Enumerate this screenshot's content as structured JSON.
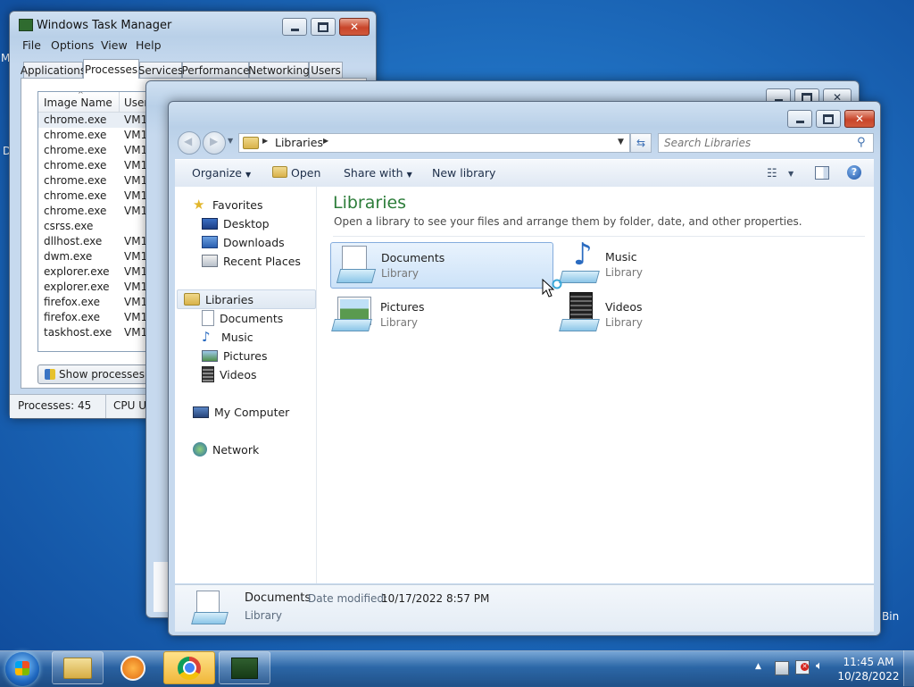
{
  "desktop": {
    "recycle_bin_label": "Bin",
    "left_edge_letters": [
      "M",
      "D"
    ]
  },
  "task_manager": {
    "title": "Windows Task Manager",
    "menu": [
      "File",
      "Options",
      "View",
      "Help"
    ],
    "tabs": [
      "Applications",
      "Processes",
      "Services",
      "Performance",
      "Networking",
      "Users"
    ],
    "columns": [
      "Image Name",
      "User Name"
    ],
    "rows": [
      {
        "name": "chrome.exe",
        "user": "VM1"
      },
      {
        "name": "chrome.exe",
        "user": "VM1"
      },
      {
        "name": "chrome.exe",
        "user": "VM1"
      },
      {
        "name": "chrome.exe",
        "user": "VM1"
      },
      {
        "name": "chrome.exe",
        "user": "VM1"
      },
      {
        "name": "chrome.exe",
        "user": "VM1"
      },
      {
        "name": "chrome.exe",
        "user": "VM1"
      },
      {
        "name": "csrss.exe",
        "user": ""
      },
      {
        "name": "dllhost.exe",
        "user": "VM1"
      },
      {
        "name": "dwm.exe",
        "user": "VM1"
      },
      {
        "name": "explorer.exe",
        "user": "VM1"
      },
      {
        "name": "explorer.exe",
        "user": "VM1"
      },
      {
        "name": "firefox.exe",
        "user": "VM1"
      },
      {
        "name": "firefox.exe",
        "user": "VM1"
      },
      {
        "name": "taskhost.exe",
        "user": "VM1"
      }
    ],
    "show_all_button": "Show processes from all u",
    "status_processes": "Processes: 45",
    "status_cpu": "CPU Usage:"
  },
  "explorer": {
    "breadcrumb": "Libraries",
    "search_placeholder": "Search Libraries",
    "toolbar": {
      "organize": "Organize",
      "open": "Open",
      "share_with": "Share with",
      "new_library": "New library"
    },
    "nav": {
      "favorites": "Favorites",
      "favorites_items": [
        "Desktop",
        "Downloads",
        "Recent Places"
      ],
      "libraries": "Libraries",
      "library_items": [
        "Documents",
        "Music",
        "Pictures",
        "Videos"
      ],
      "computer": "My Computer",
      "network": "Network"
    },
    "content_title": "Libraries",
    "content_subtitle": "Open a library to see your files and arrange them by folder, date, and other properties.",
    "tiles": [
      {
        "name": "Documents",
        "type": "Library"
      },
      {
        "name": "Music",
        "type": "Library"
      },
      {
        "name": "Pictures",
        "type": "Library"
      },
      {
        "name": "Videos",
        "type": "Library"
      }
    ],
    "details": {
      "name": "Documents",
      "modified_label": "Date modified:",
      "modified_value": "10/17/2022 8:57 PM",
      "type": "Library"
    }
  },
  "taskbar": {
    "time": "11:45 AM",
    "date": "10/28/2022"
  },
  "colors": {
    "accent_title": "#2d7d3a",
    "selection": "#cde4f8",
    "nav_selected": "#dfe8f2"
  }
}
